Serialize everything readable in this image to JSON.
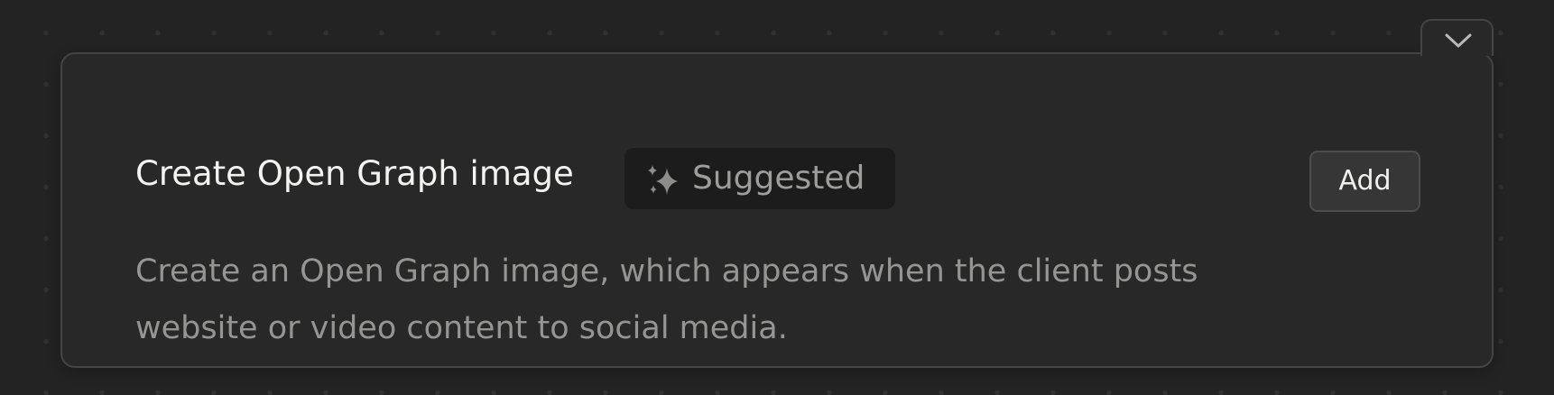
{
  "card": {
    "title": "Create Open Graph image",
    "badge": {
      "icon": "sparkles-icon",
      "label": "Suggested"
    },
    "add_label": "Add",
    "description_lines": [
      "Create an Open Graph image, which appears when the client posts",
      "website or video content to social media."
    ],
    "collapse_icon": "chevron-down-icon"
  },
  "colors": {
    "background": "#222322",
    "card": "#272827",
    "border": "#434443",
    "title_text": "#f3f3f2",
    "muted_text": "#959694",
    "badge_bg": "#1b1c1b"
  }
}
